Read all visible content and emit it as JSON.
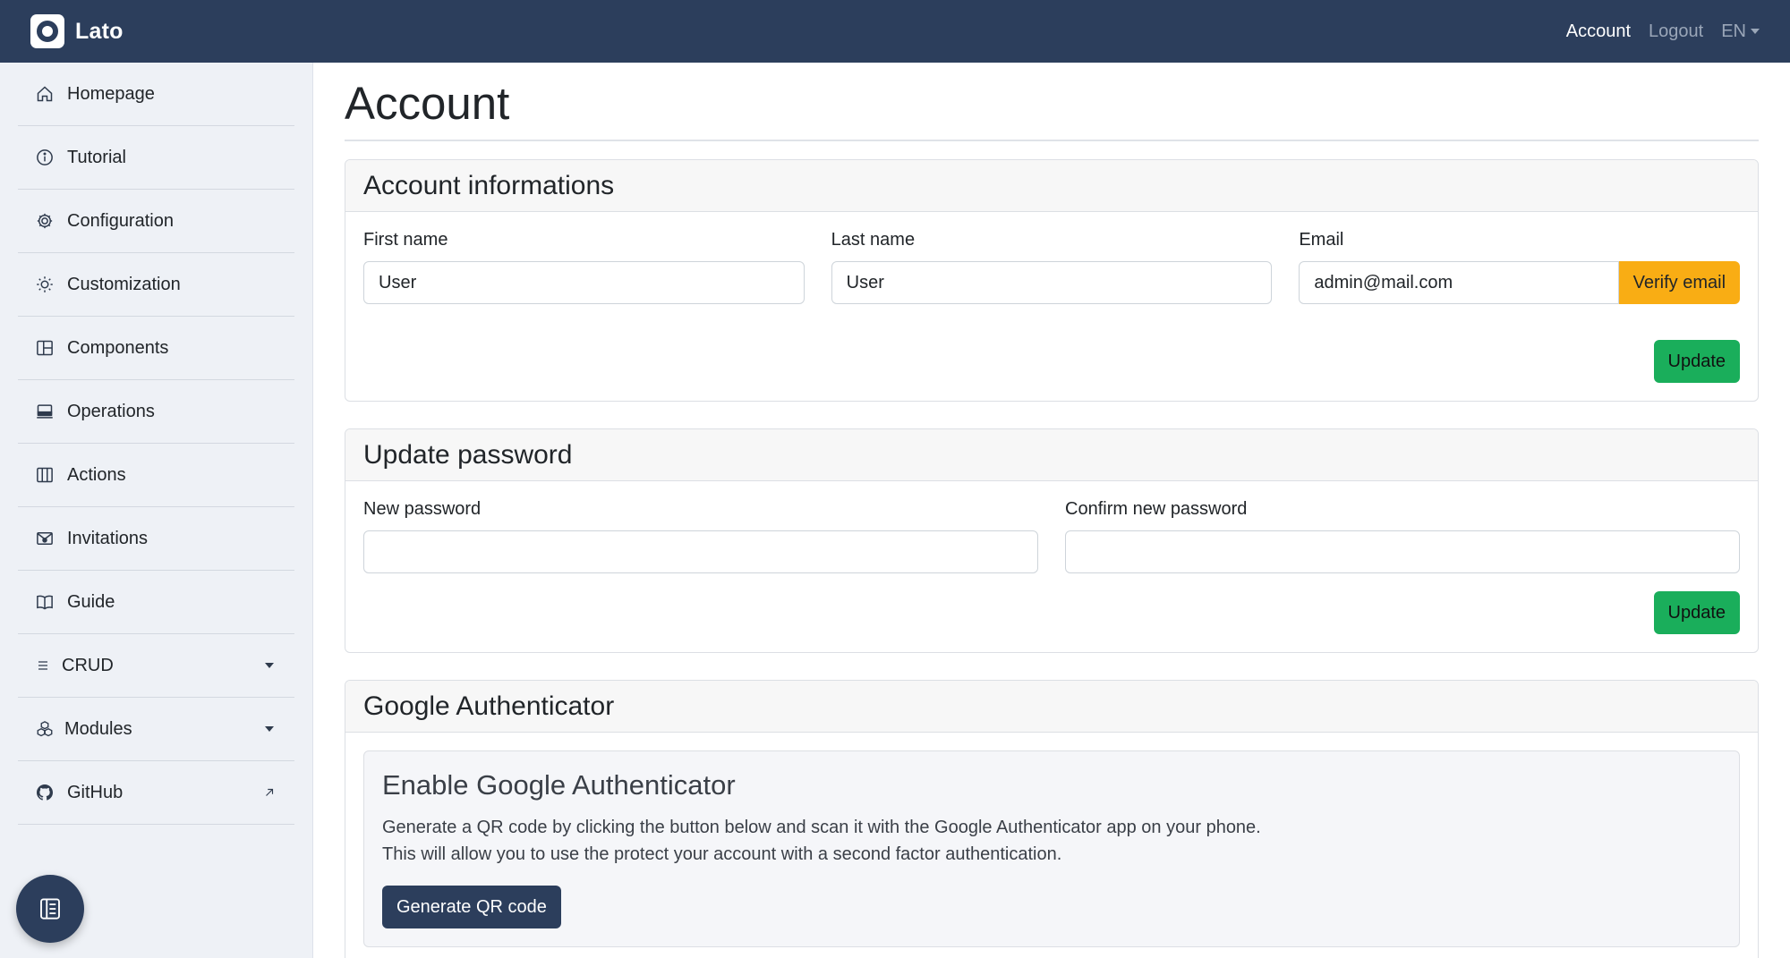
{
  "navbar": {
    "brand": "Lato",
    "links": {
      "account": "Account",
      "logout": "Logout",
      "language": "EN"
    }
  },
  "sidebar": {
    "items": [
      {
        "label": "Homepage",
        "icon": "house-icon"
      },
      {
        "label": "Tutorial",
        "icon": "info-circle-icon"
      },
      {
        "label": "Configuration",
        "icon": "gear-icon"
      },
      {
        "label": "Customization",
        "icon": "sun-icon"
      },
      {
        "label": "Components",
        "icon": "layout-icon"
      },
      {
        "label": "Operations",
        "icon": "laptop-icon"
      },
      {
        "label": "Actions",
        "icon": "columns-icon"
      },
      {
        "label": "Invitations",
        "icon": "envelope-icon"
      },
      {
        "label": "Guide",
        "icon": "book-icon"
      },
      {
        "label": "CRUD",
        "icon": "list-icon"
      },
      {
        "label": "Modules",
        "icon": "boxes-icon"
      },
      {
        "label": "GitHub",
        "icon": "github-icon"
      }
    ]
  },
  "page": {
    "title": "Account"
  },
  "account_info": {
    "header": "Account informations",
    "first_name_label": "First name",
    "first_name_value": "User",
    "last_name_label": "Last name",
    "last_name_value": "User",
    "email_label": "Email",
    "email_value": "admin@mail.com",
    "verify_label": "Verify email",
    "update_label": "Update"
  },
  "update_password": {
    "header": "Update password",
    "new_label": "New password",
    "confirm_label": "Confirm new password",
    "update_label": "Update"
  },
  "google_auth": {
    "header": "Google Authenticator",
    "title": "Enable Google Authenticator",
    "line1": "Generate a QR code by clicking the button below and scan it with the Google Authenticator app on your phone.",
    "line2": "This will allow you to use the protect your account with a second factor authentication.",
    "button": "Generate QR code"
  },
  "colors": {
    "navbar": "#2c3e5c",
    "sidebar": "#eef1f6",
    "warning": "#f9ad14",
    "success": "#1aae5b",
    "dark_button": "#2c3e5c"
  }
}
